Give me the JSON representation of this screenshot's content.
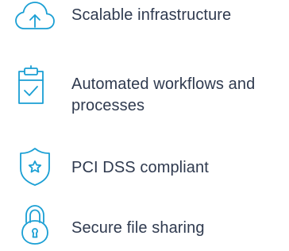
{
  "features": [
    {
      "icon": "cloud-upload-icon",
      "label": "Scalable infrastructure"
    },
    {
      "icon": "clipboard-check-icon",
      "label_line1": "Automated workflows and",
      "label_line2": "processes"
    },
    {
      "icon": "shield-star-icon",
      "label": "PCI DSS compliant"
    },
    {
      "icon": "padlock-icon",
      "label": "Secure file sharing"
    }
  ],
  "colors": {
    "icon": "#1a9fd4",
    "text": "#2f3a4f",
    "background": "#ffffff"
  }
}
